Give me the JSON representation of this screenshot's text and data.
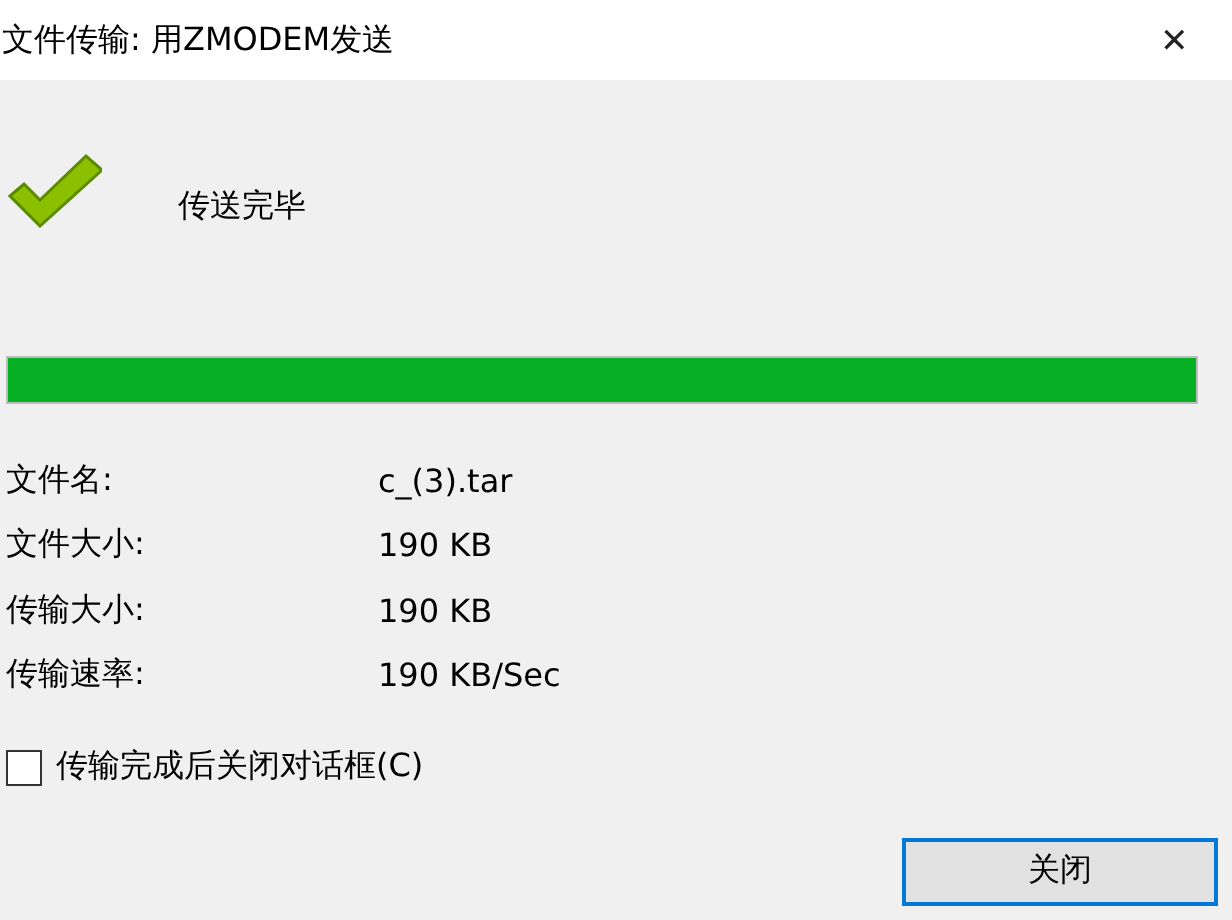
{
  "window": {
    "title": "文件传输: 用ZMODEM发送",
    "close": "✕"
  },
  "status": "传送完毕",
  "progress": {
    "level": 1
  },
  "fields": [
    {
      "label": "文件名:",
      "value": "c_(3).tar"
    },
    {
      "label": "文件大小:",
      "value": "190 KB"
    },
    {
      "label": "传输大小:",
      "value": "190 KB"
    },
    {
      "label": "传输速率:",
      "value": "190 KB/Sec"
    }
  ],
  "close_option": {
    "label": "传输完成后关闭对话框(C)",
    "checked": false
  },
  "buttons": [
    {
      "label": "关闭",
      "selected": true
    }
  ]
}
